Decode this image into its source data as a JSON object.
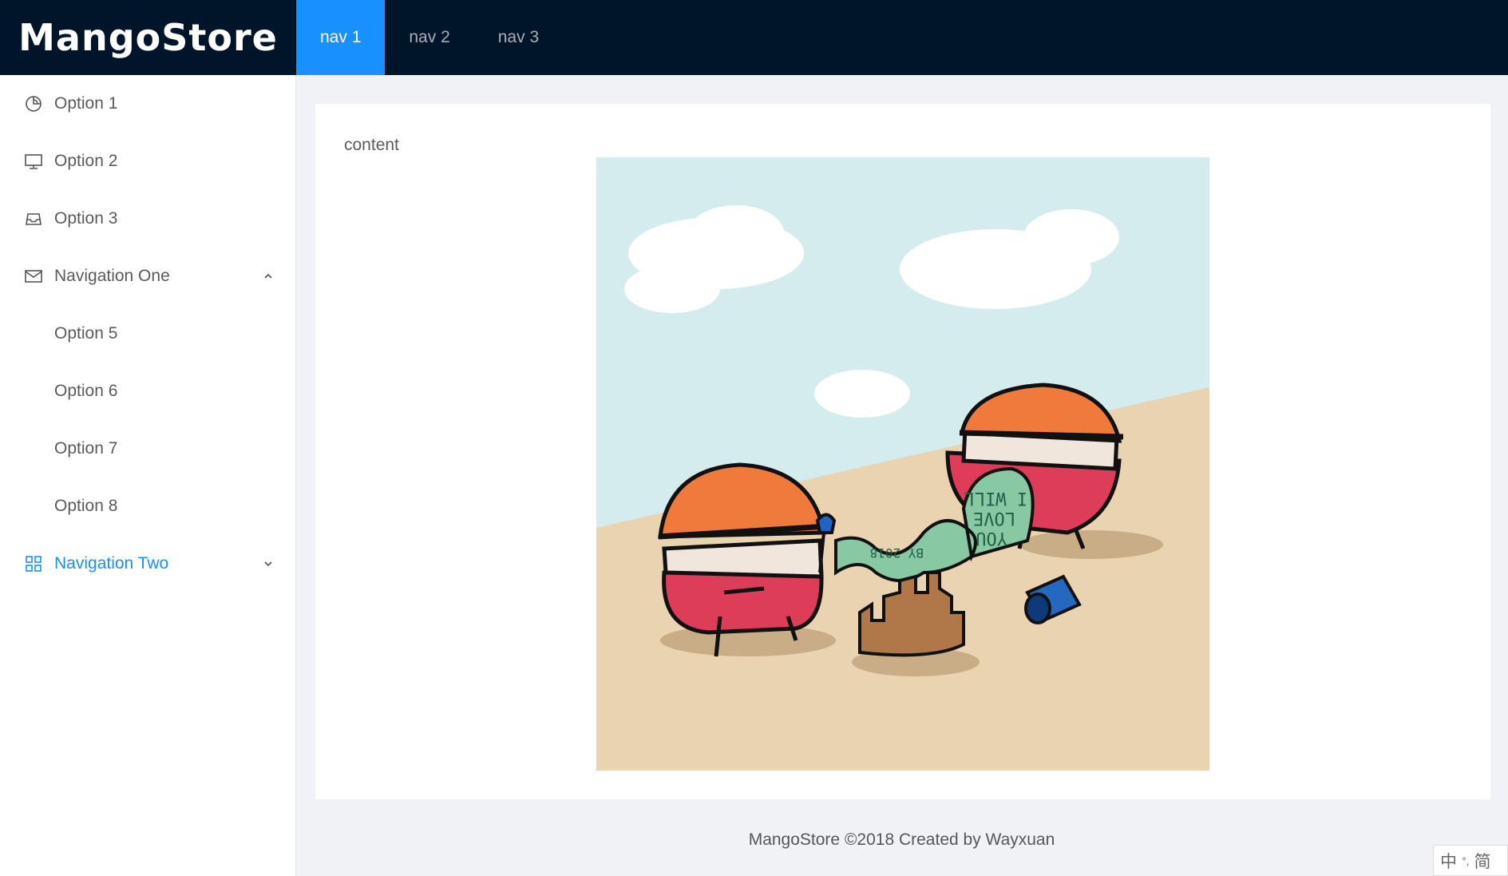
{
  "header": {
    "logo": "MangoStore",
    "nav": [
      {
        "label": "nav 1",
        "active": true
      },
      {
        "label": "nav 2",
        "active": false
      },
      {
        "label": "nav 3",
        "active": false
      }
    ]
  },
  "sidebar": {
    "items": [
      {
        "label": "Option 1",
        "icon": "pie-chart-icon"
      },
      {
        "label": "Option 2",
        "icon": "desktop-icon"
      },
      {
        "label": "Option 3",
        "icon": "inbox-icon"
      },
      {
        "label": "Navigation One",
        "icon": "mail-icon",
        "expanded": true,
        "children": [
          "Option 5",
          "Option 6",
          "Option 7",
          "Option 8"
        ]
      },
      {
        "label": "Navigation Two",
        "icon": "appstore-icon",
        "expanded": false,
        "selected": true
      }
    ]
  },
  "main": {
    "content_label": "content",
    "image_text": [
      "YOU",
      "LOVE",
      "I WILL",
      "BY 2018"
    ]
  },
  "footer": {
    "text": "MangoStore ©2018 Created by Wayxuan"
  },
  "ime": {
    "chars": [
      "中",
      "°,",
      "简"
    ]
  },
  "colors": {
    "header_bg": "#001529",
    "accent": "#1890ff",
    "page_bg": "#f0f2f5"
  }
}
